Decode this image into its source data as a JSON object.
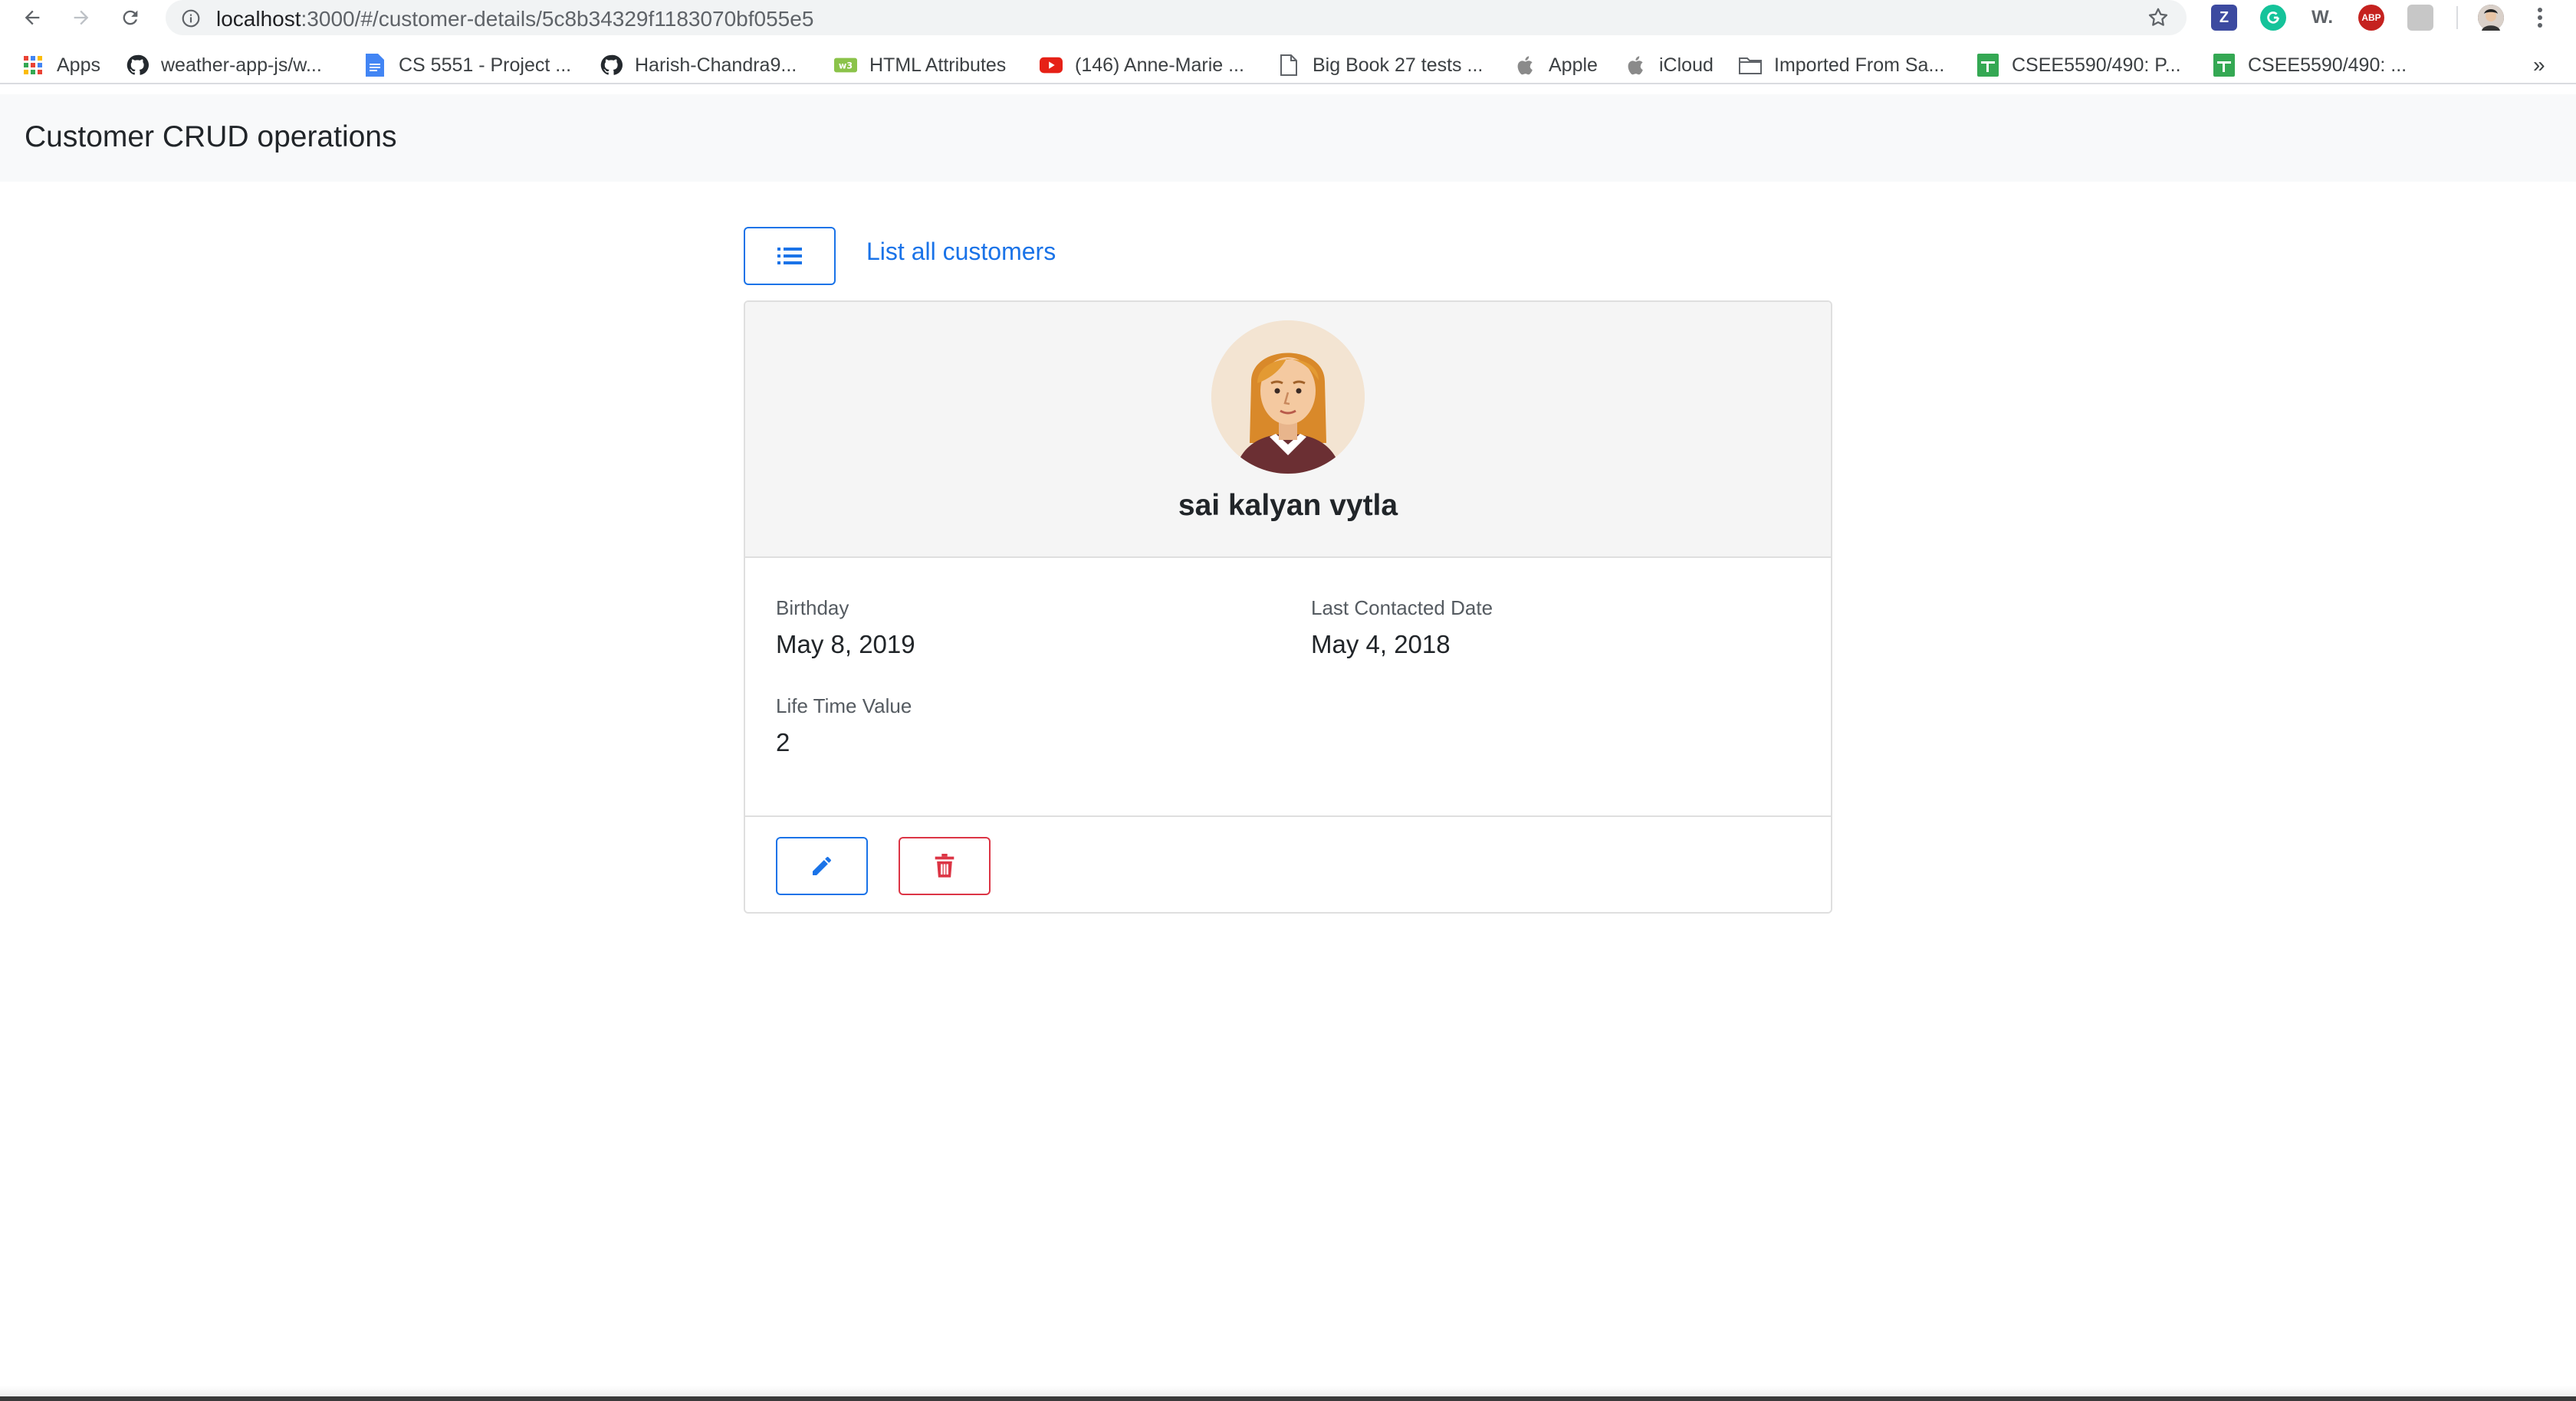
{
  "browser": {
    "url_host": "localhost",
    "url_path": ":3000/#/customer-details/5c8b34329f1183070bf055e5",
    "bookmarks": [
      {
        "label": "Apps",
        "icon": "apps-grid-icon"
      },
      {
        "label": "weather-app-js/w...",
        "icon": "github-icon"
      },
      {
        "label": "CS 5551 - Project ...",
        "icon": "google-docs-icon"
      },
      {
        "label": "Harish-Chandra9...",
        "icon": "github-icon"
      },
      {
        "label": "HTML Attributes",
        "icon": "w3-icon"
      },
      {
        "label": "(146) Anne-Marie ...",
        "icon": "youtube-icon"
      },
      {
        "label": "Big Book 27 tests ...",
        "icon": "document-icon"
      },
      {
        "label": "Apple",
        "icon": "apple-icon"
      },
      {
        "label": "iCloud",
        "icon": "apple-icon"
      },
      {
        "label": "Imported From Sa...",
        "icon": "folder-icon"
      },
      {
        "label": "CSEE5590/490: P...",
        "icon": "google-sheets-icon"
      },
      {
        "label": "CSEE5590/490: ...",
        "icon": "google-sheets-icon"
      }
    ],
    "overflow": "»",
    "extensions": {
      "zotero": "Z",
      "word": "W.",
      "adblock": "ABP"
    }
  },
  "app": {
    "brand": "Customer CRUD operations"
  },
  "content": {
    "list_link": "List all customers",
    "customer": {
      "name": "sai kalyan vytla",
      "birthday_label": "Birthday",
      "birthday": "May 8, 2019",
      "last_contacted_label": "Last Contacted Date",
      "last_contacted": "May 4, 2018",
      "ltv_label": "Life Time Value",
      "ltv": "2"
    }
  },
  "colors": {
    "primary": "#1a73e8",
    "danger": "#dc3545",
    "navbar_bg": "#f8f9fa",
    "card_header_bg": "#f5f5f5"
  }
}
